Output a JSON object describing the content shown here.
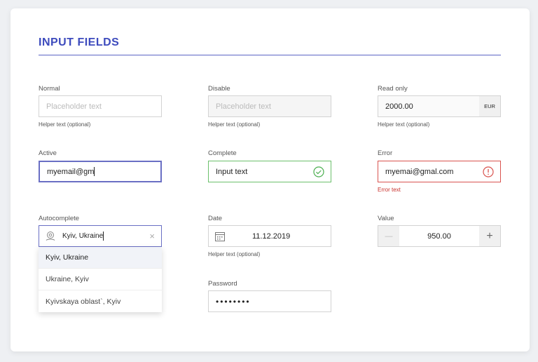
{
  "title": "INPUT FIELDS",
  "colors": {
    "accent": "#3d4bbd",
    "active_border": "#6a6fc4",
    "success": "#4caf50",
    "error": "#d9534f"
  },
  "fields": {
    "normal": {
      "label": "Normal",
      "placeholder": "Placeholder text",
      "helper": "Helper text (optional)"
    },
    "disable": {
      "label": "Disable",
      "placeholder": "Placeholder text",
      "helper": "Helper text (optional)"
    },
    "readonly": {
      "label": "Read only",
      "value": "2000.00",
      "suffix": "EUR",
      "helper": "Helper text (optional)"
    },
    "active": {
      "label": "Active",
      "value": "myemail@gm"
    },
    "complete": {
      "label": "Complete",
      "value": "Input text",
      "icon": "check-circle-icon"
    },
    "error": {
      "label": "Error",
      "value": "myemai@gmal.com",
      "error": "Error text",
      "icon": "exclamation-circle-icon"
    },
    "autocomplete": {
      "label": "Autocomplete",
      "value": "Kyiv, Ukraine",
      "options": [
        "Kyiv, Ukraine",
        "Ukraine, Kyiv",
        "Kyivskaya oblast`, Kyiv"
      ]
    },
    "date": {
      "label": "Date",
      "value": "11.12.2019",
      "helper": "Helper text (optional)"
    },
    "value": {
      "label": "Value",
      "value": "950.00",
      "minus": "—",
      "plus": "+"
    },
    "password": {
      "label": "Password",
      "value": "••••••••"
    }
  }
}
